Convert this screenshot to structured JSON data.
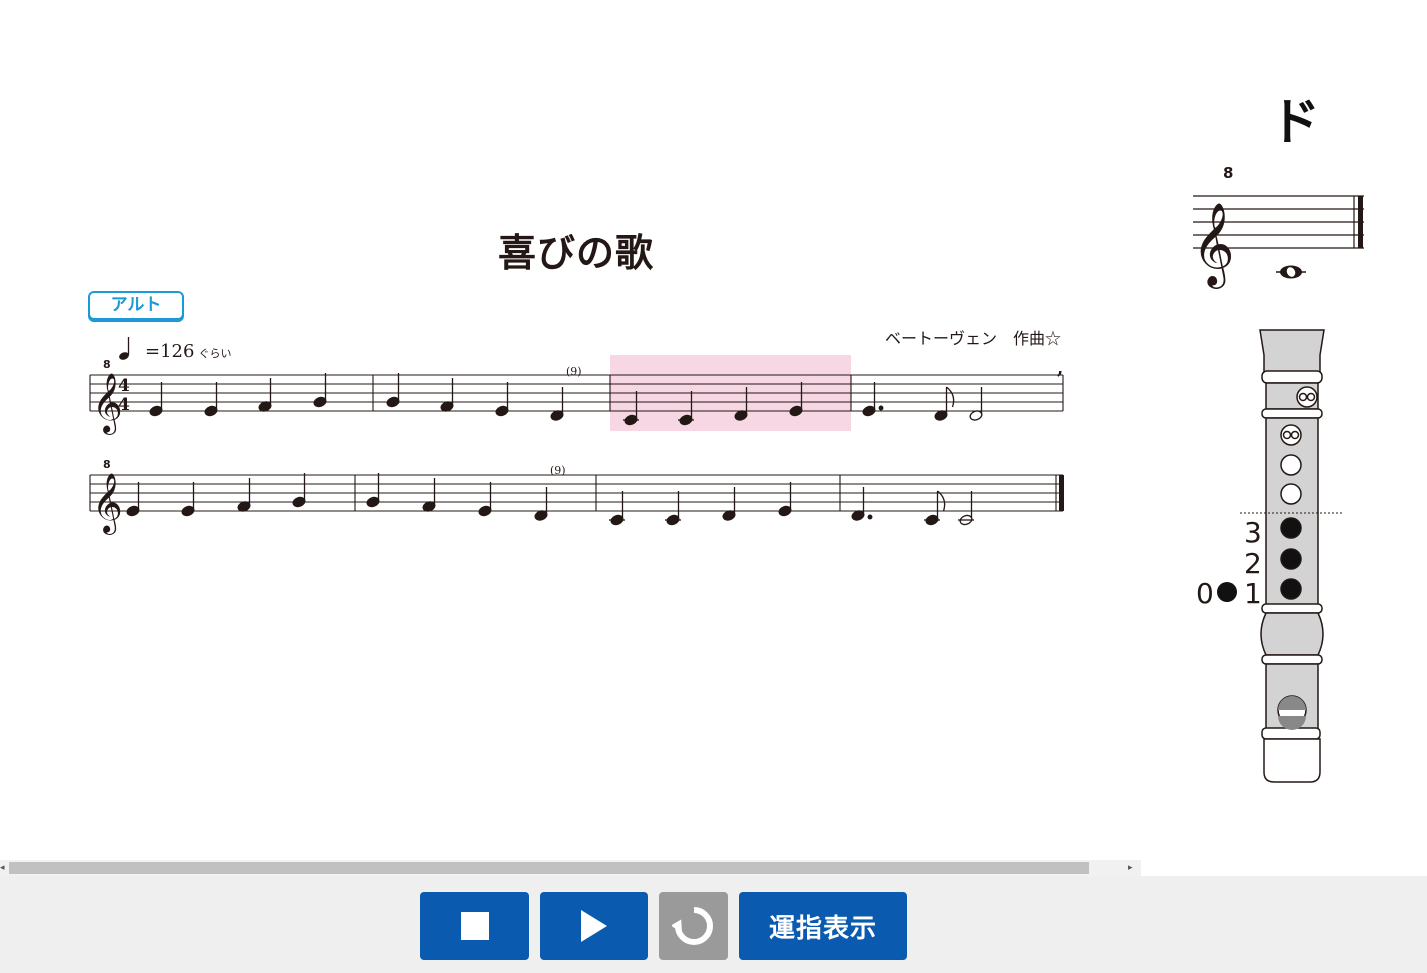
{
  "score": {
    "title": "喜びの歌",
    "part_label": "アルト",
    "composer": "ベートーヴェン　作曲☆",
    "tempo_value": "=126",
    "tempo_suffix": "ぐらい",
    "time_signature": "4/4",
    "octave_marker": "8",
    "breath_mark": "(9)",
    "highlight_color": "#f6d7e3"
  },
  "fingering": {
    "note_name": "ド",
    "octave_marker": "8",
    "hole_labels": [
      "3",
      "2",
      "1",
      "0"
    ]
  },
  "toolbar": {
    "stop_label": "stop",
    "play_label": "play",
    "replay_label": "replay",
    "fingering_label": "運指表示"
  },
  "colors": {
    "button": "#0a5bb0",
    "button_disabled": "#9a9a9a",
    "badge": "#1b9ad6"
  }
}
